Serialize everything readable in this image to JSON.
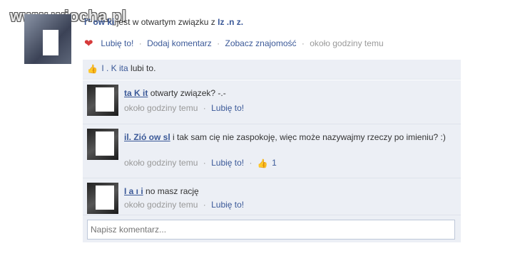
{
  "watermark": "www.wiocha.pl",
  "post": {
    "author": "l'' ow ki",
    "status_text": "jest w otwartym związku z",
    "partner": "Iz  .n  z.",
    "actions": {
      "like": "Lubię to!",
      "comment": "Dodaj komentarz",
      "friendship": "Zobacz znajomość",
      "time": "około godziny temu"
    }
  },
  "likes": {
    "names": "I  . K  ita",
    "text": "lubi to."
  },
  "comments": [
    {
      "author": "ta K  it",
      "text": "otwarty związek? -.-",
      "time": "około godziny temu",
      "like": "Lubię to!",
      "like_count": ""
    },
    {
      "author": "il. Zió  ow  sl",
      "text": "i tak sam cię nie zaspokoję, więc może nazywajmy rzeczy po imieniu? :)",
      "time": "około godziny temu",
      "like": "Lubię to!",
      "like_count": "1"
    },
    {
      "author": "I  a  ı   i",
      "text": "no masz rację",
      "time": "około godziny temu",
      "like": "Lubię to!",
      "like_count": ""
    }
  ],
  "comment_input": {
    "placeholder": "Napisz komentarz..."
  },
  "colors": {
    "link": "#3b5998",
    "panel": "#eceff5",
    "heart": "#d63a3a"
  },
  "icons": [
    "heart-icon",
    "thumbs-up-icon"
  ]
}
